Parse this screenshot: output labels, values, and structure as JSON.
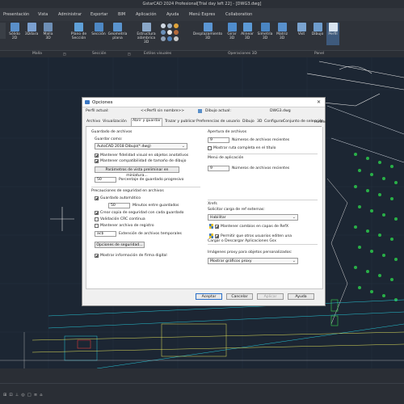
{
  "app": {
    "title": "GstarCAD 2024 Profesional[Trial day left 22] - [DWG3.dwg]"
  },
  "menu": [
    "Presentación",
    "Vista",
    "Administrar",
    "Exportar",
    "BIM",
    "Aplicación",
    "Ayuda",
    "Menú Expres",
    "Collaboration"
  ],
  "ribbon": {
    "tools": [
      "Sólido 2D",
      "3Ddara",
      "Malla 3D",
      "Plano de Sección",
      "Sección",
      "Geometría plana",
      "Estructura alámbrica 3D",
      "Desplazamiento 3D",
      "Girar 3D",
      "Alinear 3D",
      "Simetría 3D",
      "Matriz 3D",
      "Vist",
      "Dibujo",
      "Perfil"
    ],
    "groups": [
      "Malla",
      "Sección",
      "Estilos visuales",
      "Operaciones 3D",
      "Panel"
    ]
  },
  "dialog": {
    "title": "Opciones",
    "profile_label": "Perfil actual:",
    "profile_value": "<<Perfil sin nombre>>",
    "drawing_label": "Dibujo actual:",
    "drawing_value": "DWG3.dwg",
    "tabs": [
      "Archivo",
      "Visualización",
      "Abrir y guardar",
      "Trazar y publicar",
      "Preferencias de usuario",
      "Dibujo",
      "3D",
      "Configurar",
      "Conjunto de selección",
      "Perfiles"
    ],
    "left": {
      "save_group": "Guardado de archivos",
      "save_as_label": "Guardar como:",
      "save_as_value": "AutoCAD 2018 Dibujo(*.dwg)",
      "cb_fidelity": "Mantener fidelidad visual en objetos anotativos",
      "cb_compat": "Mantener compatibilidad de tamaño de dibujo",
      "thumb_button": "Parámetros de vista preliminar en miniatura...",
      "incr_value": "50",
      "incr_label": "Porcentaje de guardado progresivo",
      "safety_group": "Precauciones de seguridad en archivos",
      "cb_autosave": "Guardado automático",
      "minutes_value": "50",
      "minutes_label": "Minutos entre guardados",
      "cb_backup": "Crear copia de seguridad con cada guardado",
      "cb_crc": "Validación CRC continua",
      "cb_log": "Mantener archivo de registro",
      "ext_value": "ac$",
      "ext_label": "Extensión de archivos temporales",
      "security_button": "Opciones de seguridad...",
      "cb_signature": "Mostrar información de firma digital"
    },
    "right": {
      "open_group": "Apertura de archivos",
      "recent_value": "9",
      "recent_label": "Números de archivos recientes",
      "cb_fullpath": "Mostrar ruta completa en el título",
      "appmenu_group": "Menú de aplicación",
      "app_recent_value": "9",
      "app_recent_label": "Números de archivos recientes",
      "xref_group": "Xrefs",
      "xref_demand_label": "Solicitar carga de ref externas:",
      "xref_demand_value": "Habilitar",
      "cb_layer_changes": "Mantener cambios en capas de RefX",
      "cb_allow_edit": "Permitir que otros usuarios editen una",
      "gsx_group": "Cargar o Descargar Aplicaciones Gsx",
      "proxy_label": "Imágenes proxy para objetos personalizados:",
      "proxy_value": "Mostrar gráficos proxy"
    },
    "buttons": {
      "ok": "Aceptar",
      "cancel": "Cancelar",
      "apply": "Aplicar",
      "help": "Ayuda"
    }
  }
}
